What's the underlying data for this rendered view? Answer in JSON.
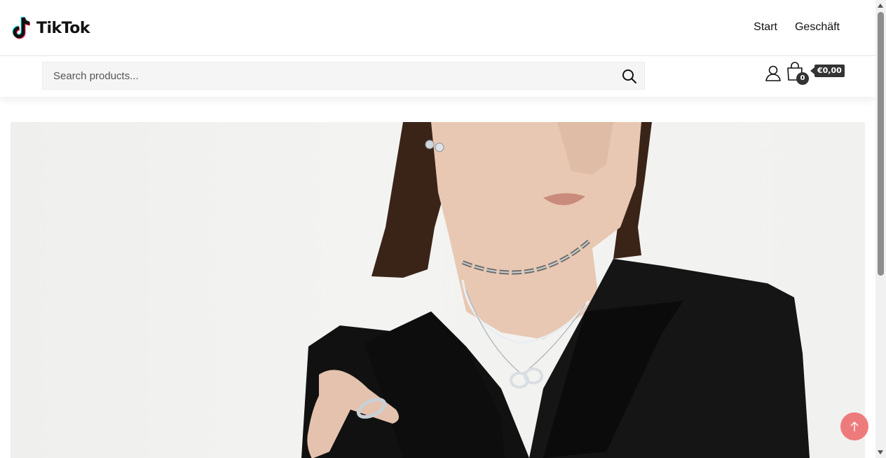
{
  "header": {
    "logo_text": "TikTok",
    "nav": [
      {
        "label": "Start"
      },
      {
        "label": "Geschäft"
      }
    ]
  },
  "search": {
    "placeholder": "Search products..."
  },
  "cart": {
    "count": "0",
    "total": "€0,00"
  },
  "icons": {
    "logo": "tiktok-note-icon",
    "search": "search-icon",
    "account": "user-icon",
    "cart": "shopping-bag-icon",
    "scroll_top": "arrow-up-icon"
  },
  "colors": {
    "accent": "#ee7b7b",
    "badge": "#333333",
    "logo_cyan": "#25f4ee",
    "logo_red": "#fe2c55"
  }
}
